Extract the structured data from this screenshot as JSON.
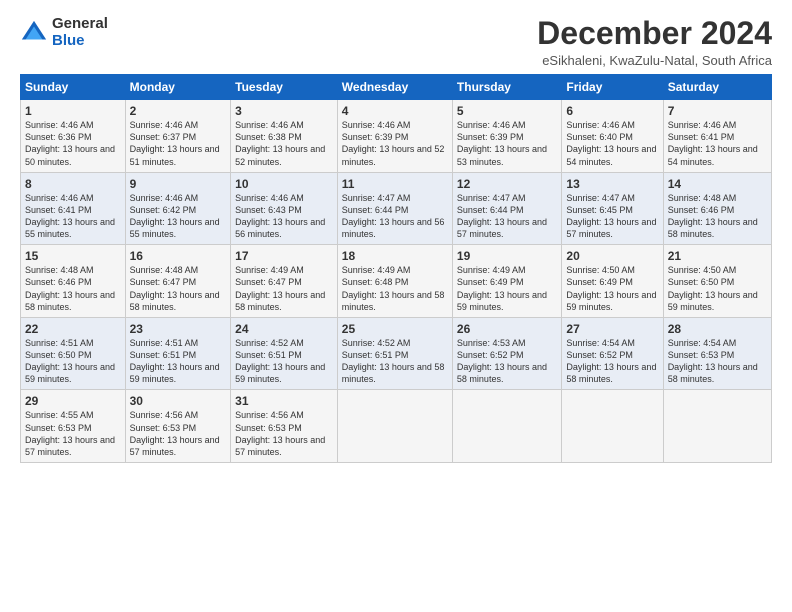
{
  "logo": {
    "general": "General",
    "blue": "Blue"
  },
  "title": "December 2024",
  "subtitle": "eSikhaleni, KwaZulu-Natal, South Africa",
  "weekdays": [
    "Sunday",
    "Monday",
    "Tuesday",
    "Wednesday",
    "Thursday",
    "Friday",
    "Saturday"
  ],
  "weeks": [
    [
      {
        "day": "1",
        "rise": "Sunrise: 4:46 AM",
        "set": "Sunset: 6:36 PM",
        "daylight": "Daylight: 13 hours and 50 minutes."
      },
      {
        "day": "2",
        "rise": "Sunrise: 4:46 AM",
        "set": "Sunset: 6:37 PM",
        "daylight": "Daylight: 13 hours and 51 minutes."
      },
      {
        "day": "3",
        "rise": "Sunrise: 4:46 AM",
        "set": "Sunset: 6:38 PM",
        "daylight": "Daylight: 13 hours and 52 minutes."
      },
      {
        "day": "4",
        "rise": "Sunrise: 4:46 AM",
        "set": "Sunset: 6:39 PM",
        "daylight": "Daylight: 13 hours and 52 minutes."
      },
      {
        "day": "5",
        "rise": "Sunrise: 4:46 AM",
        "set": "Sunset: 6:39 PM",
        "daylight": "Daylight: 13 hours and 53 minutes."
      },
      {
        "day": "6",
        "rise": "Sunrise: 4:46 AM",
        "set": "Sunset: 6:40 PM",
        "daylight": "Daylight: 13 hours and 54 minutes."
      },
      {
        "day": "7",
        "rise": "Sunrise: 4:46 AM",
        "set": "Sunset: 6:41 PM",
        "daylight": "Daylight: 13 hours and 54 minutes."
      }
    ],
    [
      {
        "day": "8",
        "rise": "Sunrise: 4:46 AM",
        "set": "Sunset: 6:41 PM",
        "daylight": "Daylight: 13 hours and 55 minutes."
      },
      {
        "day": "9",
        "rise": "Sunrise: 4:46 AM",
        "set": "Sunset: 6:42 PM",
        "daylight": "Daylight: 13 hours and 55 minutes."
      },
      {
        "day": "10",
        "rise": "Sunrise: 4:46 AM",
        "set": "Sunset: 6:43 PM",
        "daylight": "Daylight: 13 hours and 56 minutes."
      },
      {
        "day": "11",
        "rise": "Sunrise: 4:47 AM",
        "set": "Sunset: 6:44 PM",
        "daylight": "Daylight: 13 hours and 56 minutes."
      },
      {
        "day": "12",
        "rise": "Sunrise: 4:47 AM",
        "set": "Sunset: 6:44 PM",
        "daylight": "Daylight: 13 hours and 57 minutes."
      },
      {
        "day": "13",
        "rise": "Sunrise: 4:47 AM",
        "set": "Sunset: 6:45 PM",
        "daylight": "Daylight: 13 hours and 57 minutes."
      },
      {
        "day": "14",
        "rise": "Sunrise: 4:48 AM",
        "set": "Sunset: 6:46 PM",
        "daylight": "Daylight: 13 hours and 58 minutes."
      }
    ],
    [
      {
        "day": "15",
        "rise": "Sunrise: 4:48 AM",
        "set": "Sunset: 6:46 PM",
        "daylight": "Daylight: 13 hours and 58 minutes."
      },
      {
        "day": "16",
        "rise": "Sunrise: 4:48 AM",
        "set": "Sunset: 6:47 PM",
        "daylight": "Daylight: 13 hours and 58 minutes."
      },
      {
        "day": "17",
        "rise": "Sunrise: 4:49 AM",
        "set": "Sunset: 6:47 PM",
        "daylight": "Daylight: 13 hours and 58 minutes."
      },
      {
        "day": "18",
        "rise": "Sunrise: 4:49 AM",
        "set": "Sunset: 6:48 PM",
        "daylight": "Daylight: 13 hours and 58 minutes."
      },
      {
        "day": "19",
        "rise": "Sunrise: 4:49 AM",
        "set": "Sunset: 6:49 PM",
        "daylight": "Daylight: 13 hours and 59 minutes."
      },
      {
        "day": "20",
        "rise": "Sunrise: 4:50 AM",
        "set": "Sunset: 6:49 PM",
        "daylight": "Daylight: 13 hours and 59 minutes."
      },
      {
        "day": "21",
        "rise": "Sunrise: 4:50 AM",
        "set": "Sunset: 6:50 PM",
        "daylight": "Daylight: 13 hours and 59 minutes."
      }
    ],
    [
      {
        "day": "22",
        "rise": "Sunrise: 4:51 AM",
        "set": "Sunset: 6:50 PM",
        "daylight": "Daylight: 13 hours and 59 minutes."
      },
      {
        "day": "23",
        "rise": "Sunrise: 4:51 AM",
        "set": "Sunset: 6:51 PM",
        "daylight": "Daylight: 13 hours and 59 minutes."
      },
      {
        "day": "24",
        "rise": "Sunrise: 4:52 AM",
        "set": "Sunset: 6:51 PM",
        "daylight": "Daylight: 13 hours and 59 minutes."
      },
      {
        "day": "25",
        "rise": "Sunrise: 4:52 AM",
        "set": "Sunset: 6:51 PM",
        "daylight": "Daylight: 13 hours and 58 minutes."
      },
      {
        "day": "26",
        "rise": "Sunrise: 4:53 AM",
        "set": "Sunset: 6:52 PM",
        "daylight": "Daylight: 13 hours and 58 minutes."
      },
      {
        "day": "27",
        "rise": "Sunrise: 4:54 AM",
        "set": "Sunset: 6:52 PM",
        "daylight": "Daylight: 13 hours and 58 minutes."
      },
      {
        "day": "28",
        "rise": "Sunrise: 4:54 AM",
        "set": "Sunset: 6:53 PM",
        "daylight": "Daylight: 13 hours and 58 minutes."
      }
    ],
    [
      {
        "day": "29",
        "rise": "Sunrise: 4:55 AM",
        "set": "Sunset: 6:53 PM",
        "daylight": "Daylight: 13 hours and 57 minutes."
      },
      {
        "day": "30",
        "rise": "Sunrise: 4:56 AM",
        "set": "Sunset: 6:53 PM",
        "daylight": "Daylight: 13 hours and 57 minutes."
      },
      {
        "day": "31",
        "rise": "Sunrise: 4:56 AM",
        "set": "Sunset: 6:53 PM",
        "daylight": "Daylight: 13 hours and 57 minutes."
      },
      null,
      null,
      null,
      null
    ]
  ]
}
